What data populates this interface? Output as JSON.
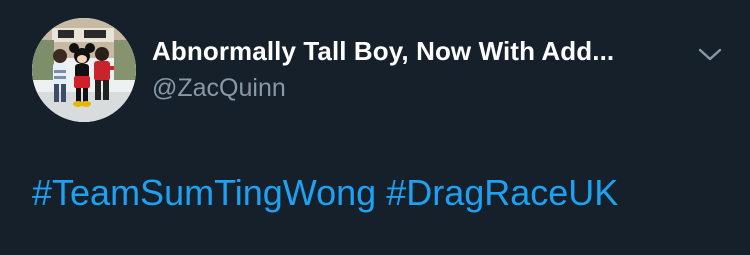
{
  "tweet": {
    "author": {
      "display_name": "Abnormally Tall Boy, Now With Add...",
      "handle": "@ZacQuinn",
      "avatar_icon": "profile-photo"
    },
    "menu_icon": "chevron-down-icon",
    "hashtags": [
      "#TeamSumTingWong",
      "#DragRaceUK"
    ]
  },
  "colors": {
    "background": "#15202b",
    "display_name": "#ffffff",
    "handle": "#8899a6",
    "link": "#1da1f2",
    "chevron": "#8899a6"
  }
}
